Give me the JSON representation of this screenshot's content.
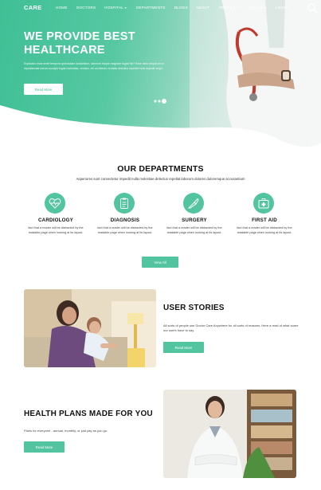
{
  "brand": "CARE",
  "nav": {
    "home": "HOME",
    "doctors": "DOCTORS",
    "hospital": "HOSPITAL",
    "departments": "DEPARTMENTS",
    "blogs": "BLOGS",
    "about": "ABOUT",
    "profile": "PROFILE",
    "signup": "SIGNUP",
    "login": "LOGIN"
  },
  "hero": {
    "title": "WE PROVIDE BEST HEALTHCARE",
    "text": "Explicabo esse amet tempora quibusdam laudantium, laborum eaque magnam fugiat hic? Esse dicta aliquid error repudiandae earum suscipit fugiat molestias, veniam, vel architecto veritatis delectus repellat modi impedit sequi.",
    "button": "Read More",
    "slides": 3,
    "active_slide": 3
  },
  "departments": {
    "title": "OUR DEPARTMENTS",
    "subtitle": "Asperiores sunt consectetur impedit nulla molestiae delectus repellat laborum dolores doloremque accusantium",
    "cards": [
      {
        "icon": "heart-pulse-icon",
        "title": "CARDIOLOGY",
        "text": "fact that a reader will be distracted by the readable page when looking at its layout."
      },
      {
        "icon": "clipboard-icon",
        "title": "DIAGNOSIS",
        "text": "fact that a reader will be distracted by the readable page when looking at its layout."
      },
      {
        "icon": "scalpel-icon",
        "title": "SURGERY",
        "text": "fact that a reader will be distracted by the readable page when looking at its layout."
      },
      {
        "icon": "first-aid-kit-icon",
        "title": "FIRST AID",
        "text": "fact that a reader will be distracted by the readable page when looking at its layout."
      }
    ],
    "button": "View All"
  },
  "stories": {
    "title": "USER STORIES",
    "text": "All sorts of people use Doctor Care Anywhere for all sorts of reasons. Here a read of what some our users have to say.",
    "button": "Read More"
  },
  "plans": {
    "title": "HEALTH PLANS MADE FOR YOU",
    "text": "Plans for everyone - annual, monthly, or just pay as you go.",
    "button": "Read More"
  },
  "colors": {
    "accent": "#52c49f",
    "hero_green": "#3fbf95",
    "text_dark": "#111111"
  }
}
